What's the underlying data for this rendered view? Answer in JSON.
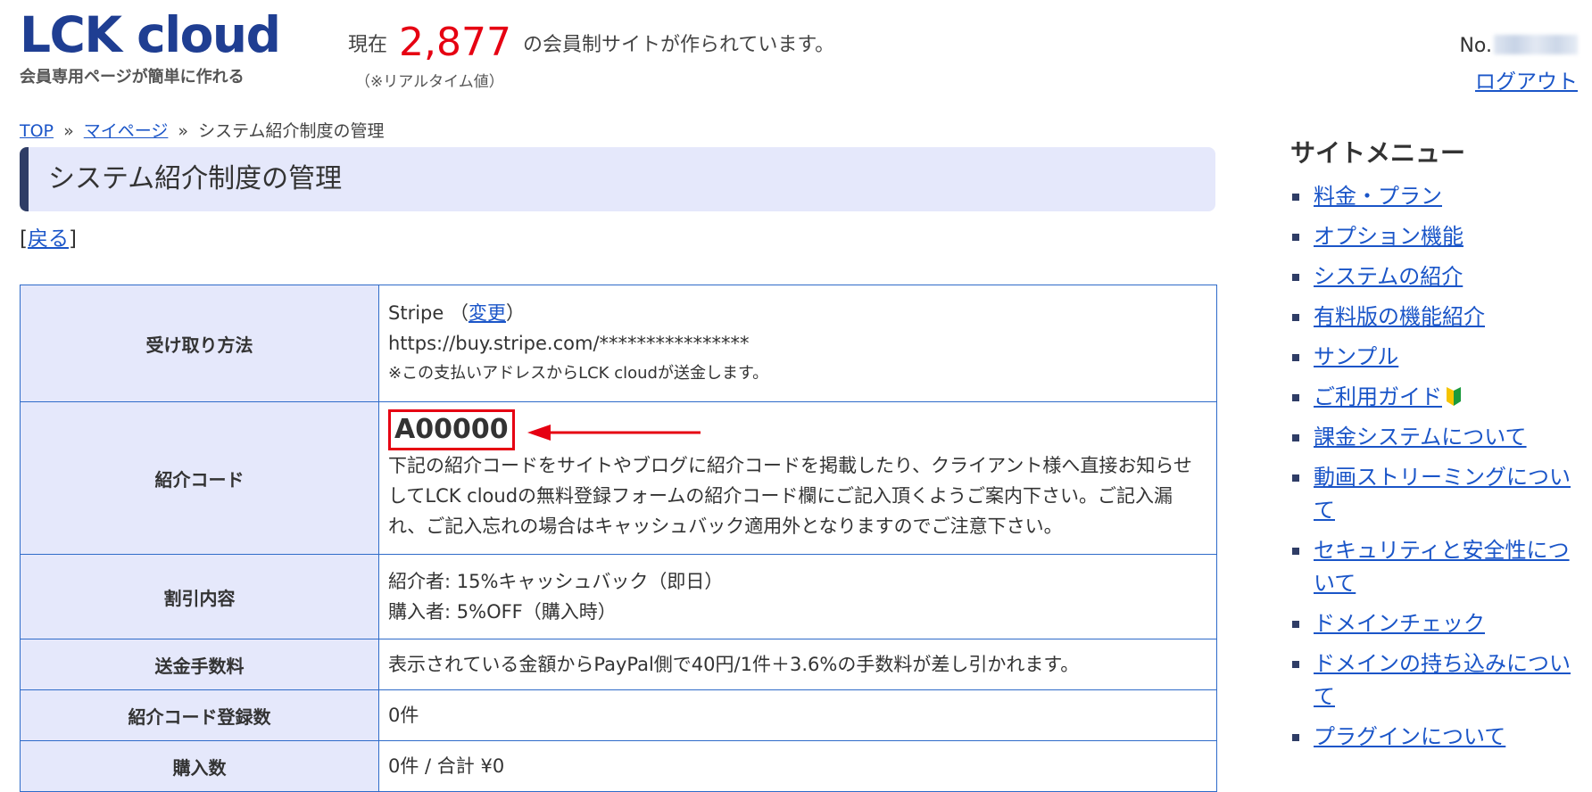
{
  "header": {
    "logo_text": "LCK cloud",
    "tagline": "会員専用ページが簡単に作れる",
    "counter_prefix": "現在",
    "counter_value": "2,877",
    "counter_suffix": "の会員制サイトが作られています。",
    "counter_note": "（※リアルタイム値）",
    "user_no_label": "No.",
    "logout_label": "ログアウト"
  },
  "breadcrumb": {
    "items": [
      "TOP",
      "マイページ",
      "システム紹介制度の管理"
    ],
    "separator": "»"
  },
  "page_title": "システム紹介制度の管理",
  "back_link": {
    "open": "[",
    "label": "戻る",
    "close": "]"
  },
  "table": {
    "payment": {
      "label": "受け取り方法",
      "method": "Stripe",
      "change_open": "（",
      "change_label": "変更",
      "change_close": "）",
      "url": "https://buy.stripe.com/****************",
      "note": "※この支払いアドレスからLCK cloudが送金します。"
    },
    "referral": {
      "label": "紹介コード",
      "code": "A00000",
      "description": "下記の紹介コードをサイトやブログに紹介コードを掲載したり、クライアント様へ直接お知らせしてLCK cloudの無料登録フォームの紹介コード欄にご記入頂くようご案内下さい。ご記入漏れ、ご記入忘れの場合はキャッシュバック適用外となりますのでご注意下さい。"
    },
    "discount": {
      "label": "割引内容",
      "line1": "紹介者: 15%キャッシュバック（即日）",
      "line2": "購入者: 5%OFF（購入時）"
    },
    "fee": {
      "label": "送金手数料",
      "value": "表示されている金額からPayPal側で40円/1件＋3.6%の手数料が差し引かれます。"
    },
    "registrations": {
      "label": "紹介コード登録数",
      "value": "0件"
    },
    "purchases": {
      "label": "購入数",
      "value": "0件 / 合計 ¥0"
    }
  },
  "site_menu": {
    "title": "サイトメニュー",
    "items": [
      {
        "label": "料金・プラン"
      },
      {
        "label": "オプション機能"
      },
      {
        "label": "システムの紹介"
      },
      {
        "label": "有料版の機能紹介"
      },
      {
        "label": "サンプル"
      },
      {
        "label": "ご利用ガイド",
        "icon": "beginner-leaf-icon"
      },
      {
        "label": "課金システムについて"
      },
      {
        "label": "動画ストリーミングについて"
      },
      {
        "label": "セキュリティと安全性について"
      },
      {
        "label": "ドメインチェック"
      },
      {
        "label": "ドメインの持ち込みについて"
      },
      {
        "label": "プラグインについて"
      }
    ]
  },
  "colors": {
    "brand": "#1f3e92",
    "counter": "#e60012",
    "link": "#1a55c8",
    "header_cell_bg": "#e5e8fb",
    "table_border": "#2f6bc9",
    "highlight": "#e60012"
  }
}
